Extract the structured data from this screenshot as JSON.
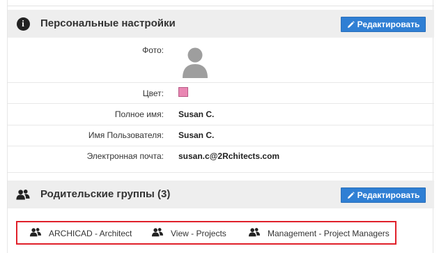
{
  "personal": {
    "title": "Персональные настройки",
    "edit_label": "Редактировать",
    "photo_label": "Фото:",
    "color_label": "Цвет:",
    "color_value": "#e987b3",
    "fullname_label": "Полное имя:",
    "fullname_value": "Susan C.",
    "username_label": "Имя Пользователя:",
    "username_value": "Susan C.",
    "email_label": "Электронная почта:",
    "email_value": "susan.c@2Rchitects.com"
  },
  "groups": {
    "title": "Родительские группы (3)",
    "edit_label": "Редактировать",
    "items": [
      {
        "label": "ARCHICAD - Architect",
        "icon": "users-icon"
      },
      {
        "label": "View - Projects",
        "icon": "users-icon"
      },
      {
        "label": "Management - Project Managers",
        "icon": "users-icon"
      }
    ]
  },
  "colors": {
    "accent": "#2f7fd4",
    "header_bg": "#eeeeee",
    "highlight": "#e0202a"
  }
}
